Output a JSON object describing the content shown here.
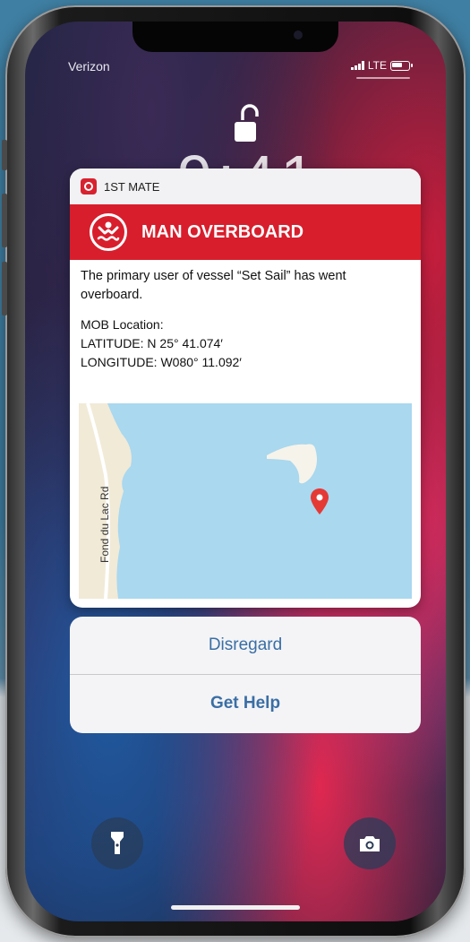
{
  "status_bar": {
    "carrier": "Verizon",
    "network": "LTE"
  },
  "lock_screen": {
    "time_partial": "9:41"
  },
  "notification": {
    "app_name": "1ST MATE",
    "banner_title": "MAN OVERBOARD",
    "message": "The primary user of vessel “Set Sail” has went overboard.",
    "location_heading": "MOB Location:",
    "latitude": "LATITUDE: N 25° 41.074′",
    "longitude": "LONGITUDE: W080° 11.092′",
    "map": {
      "road_label": "Fond du Lac Rd"
    }
  },
  "actions": {
    "disregard_label": "Disregard",
    "get_help_label": "Get Help"
  },
  "icons": {
    "flashlight": "flashlight-icon",
    "camera": "camera-icon",
    "lock": "unlock-icon",
    "pin": "map-pin-icon"
  },
  "colors": {
    "alert_red": "#d81e2c",
    "action_blue": "#3a6ea5",
    "water": "#a9d8ef"
  }
}
